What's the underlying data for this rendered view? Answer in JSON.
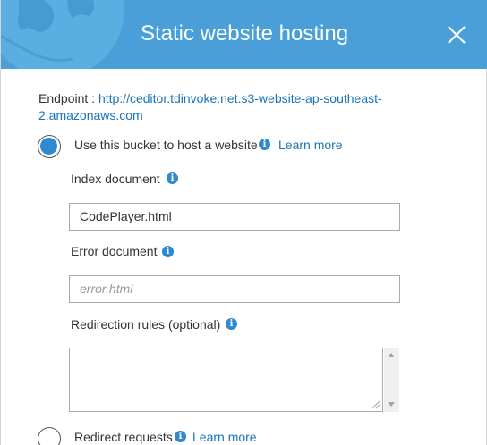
{
  "dialog": {
    "title": "Static website hosting",
    "close_icon": "close-icon"
  },
  "endpoint": {
    "label": "Endpoint : ",
    "url": "http://ceditor.tdinvoke.net.s3-website-ap-southeast-2.amazonaws.com"
  },
  "options": {
    "host": {
      "label": "Use this bucket to host a website",
      "selected": true,
      "learn_more": "Learn more"
    },
    "redirect": {
      "label": "Redirect requests",
      "selected": false,
      "learn_more": "Learn more"
    }
  },
  "fields": {
    "index": {
      "label": "Index document",
      "value": "CodePlayer.html"
    },
    "error": {
      "label": "Error document",
      "placeholder": "error.html"
    },
    "redirection": {
      "label": "Redirection rules (optional)",
      "value": ""
    }
  },
  "colors": {
    "header": "#4a9fd8",
    "accent": "#2e89d1",
    "link": "#1a73b8"
  }
}
